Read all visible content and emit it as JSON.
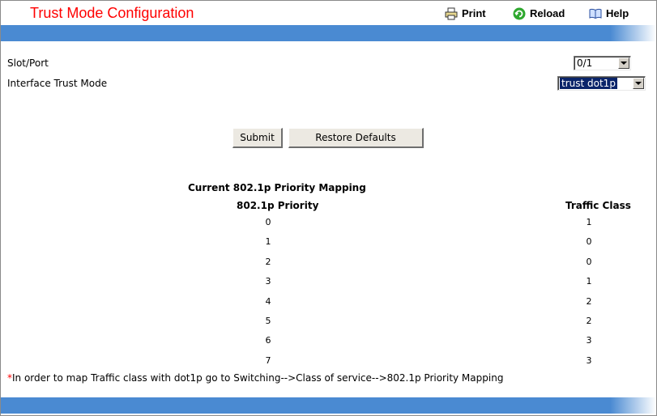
{
  "header": {
    "title": "Trust Mode Configuration",
    "print_label": "Print",
    "reload_label": "Reload",
    "help_label": "Help"
  },
  "form": {
    "slot_port_label": "Slot/Port",
    "slot_port_value": "0/1",
    "trust_mode_label": "Interface Trust Mode",
    "trust_mode_value": "trust dot1p",
    "submit_label": "Submit",
    "restore_label": "Restore Defaults"
  },
  "mapping": {
    "title": "Current 802.1p Priority Mapping",
    "col_priority": "802.1p Priority",
    "col_class": "Traffic Class",
    "rows": [
      {
        "priority": "0",
        "class": "1"
      },
      {
        "priority": "1",
        "class": "0"
      },
      {
        "priority": "2",
        "class": "0"
      },
      {
        "priority": "3",
        "class": "1"
      },
      {
        "priority": "4",
        "class": "2"
      },
      {
        "priority": "5",
        "class": "2"
      },
      {
        "priority": "6",
        "class": "3"
      },
      {
        "priority": "7",
        "class": "3"
      }
    ]
  },
  "footnote": {
    "star": "*",
    "text": "In order to map Traffic class with dot1p go to Switching-->Class of service-->802.1p Priority Mapping"
  },
  "colors": {
    "title": "#ff0000",
    "bar": "#4a8ad2",
    "select_highlight": "#0a246a"
  }
}
